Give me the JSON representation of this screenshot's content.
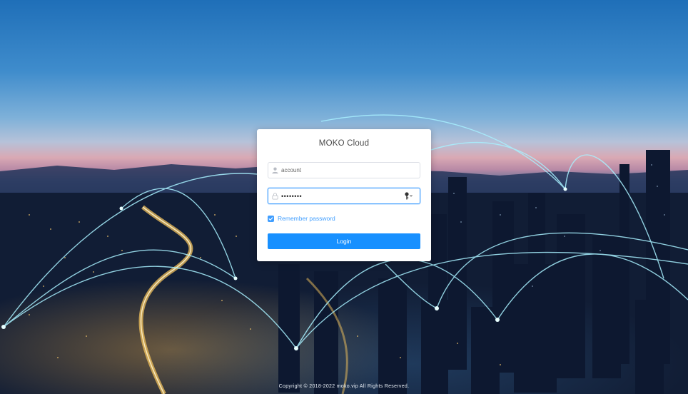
{
  "login": {
    "title": "MOKO Cloud",
    "account_placeholder": "account",
    "password_value": "12345678",
    "remember_label": "Remember password",
    "remember_checked": true,
    "login_button_label": "Login"
  },
  "footer": {
    "copyright": "Copyright © 2018-2022 moko.vip All Rights Reserved."
  },
  "icons": {
    "account_icon": "user-icon",
    "password_icon": "lock-icon",
    "password_toggle_icon": "key-icon",
    "checkbox_icon": "check-icon"
  },
  "colors": {
    "primary": "#1890ff",
    "focus_border": "#409eff",
    "card_bg": "#ffffff"
  }
}
